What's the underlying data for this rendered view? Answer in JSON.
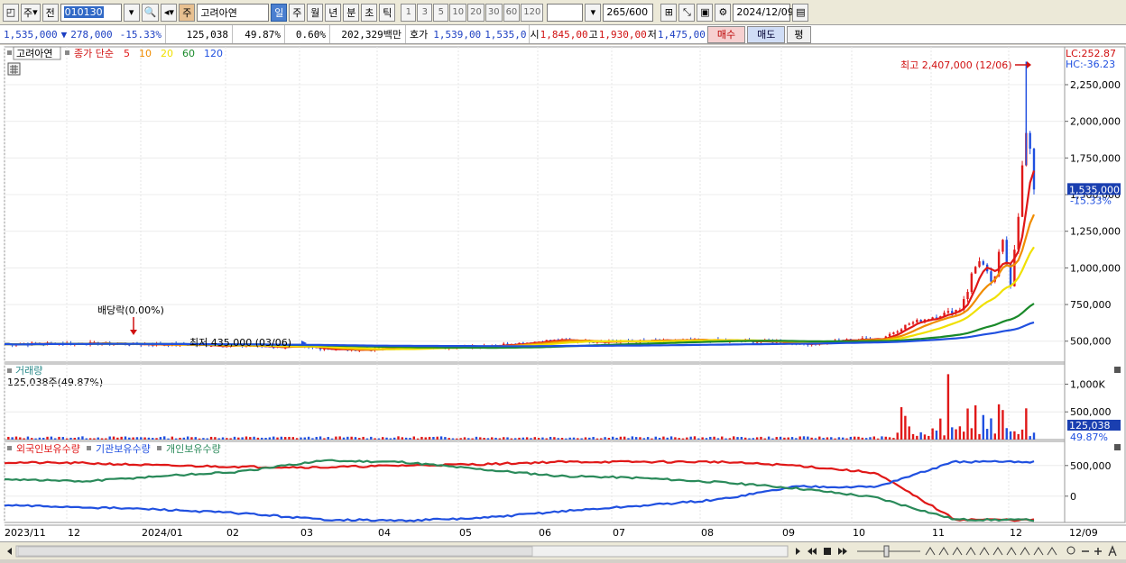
{
  "toolbar": {
    "type_label": "주",
    "prev_label": "전",
    "stock_code": "010130",
    "stock_kind": "주",
    "stock_name": "고려아연",
    "periods": [
      "일",
      "주",
      "월",
      "년",
      "분",
      "초",
      "틱"
    ],
    "selected_period": "일",
    "intervals": [
      "1",
      "3",
      "5",
      "10",
      "20",
      "30",
      "60",
      "120"
    ],
    "count_value": "265",
    "count_total": "/600",
    "date_value": "2024/12/09"
  },
  "infobar": {
    "price": "1,535,000",
    "change_arrow": "▼",
    "change": "278,000",
    "change_pct": "-15.33%",
    "volume": "125,038",
    "volume_pct": "49.87%",
    "turnover_pct": "0.60%",
    "amount": "202,329백만",
    "quote_label": "호가",
    "bid": "1,539,00",
    "ask": "1,535,0",
    "open_label": "시",
    "open": "1,845,00",
    "high_label": "고",
    "high": "1,930,00",
    "low_label": "저",
    "low": "1,475,00",
    "buy_label": "매수",
    "sell_label": "매도",
    "avg_label": "평"
  },
  "price_panel": {
    "legend_name": "고려아연",
    "ma_label": "종가 단순",
    "ma_periods": [
      "5",
      "10",
      "20",
      "60",
      "120"
    ],
    "ma_colors": [
      "#e01818",
      "#f08c00",
      "#f0e000",
      "#1a8a2a",
      "#2050e0"
    ],
    "lc_label": "LC:252.87",
    "hc_label": "HC:-36.23",
    "high_note": "최고 2,407,000 (12/06)",
    "low_note": "최저 435,000 (03/06)",
    "dividend_note": "배당락(0.00%)",
    "current_price_tag": "1,535,000",
    "current_change_tag": "-15.33%",
    "y_ticks": [
      "2,250,000",
      "2,000,000",
      "1,750,000",
      "1,500,000",
      "1,250,000",
      "1,000,000",
      "750,000",
      "500,000"
    ]
  },
  "volume_panel": {
    "title": "거래량",
    "value_text": "125,038주(49.87%)",
    "y_ticks": [
      "1,000K",
      "500,000"
    ],
    "current_tag": "125,038",
    "pct_tag": "49.87%"
  },
  "holdings_panel": {
    "series": [
      "외국인보유수량",
      "기관보유수량",
      "개인보유수량"
    ],
    "series_colors": [
      "#e01818",
      "#2050e0",
      "#2a8a5a"
    ],
    "y_ticks": [
      "500,000",
      "0"
    ]
  },
  "x_axis": {
    "labels": [
      "2023/11",
      "12",
      "2024/01",
      "02",
      "03",
      "04",
      "05",
      "06",
      "07",
      "08",
      "09",
      "10",
      "11",
      "12"
    ],
    "end_label": "12/09"
  },
  "chart_data": [
    {
      "type": "line",
      "title": "고려아연",
      "ylim": [
        400000,
        2450000
      ],
      "x": [
        "2023/11",
        "12",
        "2024/01",
        "02",
        "03",
        "04",
        "05",
        "06",
        "07",
        "08",
        "09",
        "10",
        "11",
        "12/06",
        "12/09"
      ],
      "series": [
        {
          "name": "종가",
          "values": [
            480000,
            490000,
            470000,
            460000,
            440000,
            450000,
            500000,
            490000,
            510000,
            470000,
            520000,
            700000,
            1100000,
            2407000,
            1535000
          ]
        },
        {
          "name": "120",
          "values": [
            470000,
            475000,
            475000,
            470000,
            465000,
            460000,
            465000,
            470000,
            480000,
            480000,
            490000,
            530000,
            600000,
            700000,
            740000
          ]
        }
      ]
    },
    {
      "type": "bar",
      "title": "거래량",
      "ylim": [
        0,
        1300000
      ],
      "categories": [
        "2023/11",
        "12",
        "2024/01",
        "02",
        "03",
        "04",
        "05",
        "06",
        "07",
        "08",
        "09",
        "10",
        "11",
        "12"
      ],
      "values": [
        40000,
        45000,
        30000,
        25000,
        30000,
        30000,
        35000,
        30000,
        30000,
        35000,
        50000,
        600000,
        300000,
        125038
      ]
    },
    {
      "type": "line",
      "title": "외국인보유수량 / 기관보유수량 / 개인보유수량",
      "ylim": [
        -500000,
        700000
      ],
      "x": [
        "2023/11",
        "12",
        "2024/01",
        "02",
        "03",
        "04",
        "05",
        "06",
        "07",
        "08",
        "09",
        "10",
        "11",
        "12"
      ],
      "series": [
        {
          "name": "외국인보유수량",
          "values": [
            550000,
            540000,
            500000,
            480000,
            470000,
            500000,
            520000,
            560000,
            560000,
            560000,
            500000,
            380000,
            -380000,
            -390000
          ]
        },
        {
          "name": "기관보유수량",
          "values": [
            -150000,
            -180000,
            -220000,
            -280000,
            -380000,
            -400000,
            -360000,
            -250000,
            -160000,
            -60000,
            160000,
            150000,
            560000,
            560000
          ]
        },
        {
          "name": "개인보유수량",
          "values": [
            280000,
            240000,
            330000,
            400000,
            580000,
            560000,
            440000,
            330000,
            300000,
            230000,
            130000,
            -20000,
            -380000,
            -390000
          ]
        }
      ]
    }
  ]
}
